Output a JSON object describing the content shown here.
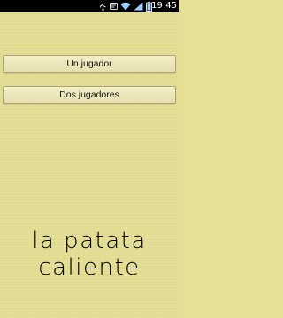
{
  "status_bar": {
    "time": "19:45",
    "icons": [
      "usb-icon",
      "notification-icon",
      "wifi-icon",
      "signal-icon",
      "battery-icon"
    ]
  },
  "menu": {
    "one_player_label": "Un jugador",
    "two_players_label": "Dos jugadores"
  },
  "logo": {
    "line1": "la patata",
    "line2": "caliente"
  },
  "colors": {
    "background": "#e6df96",
    "button_background": "#efe9bd",
    "status_bar": "#000000"
  }
}
